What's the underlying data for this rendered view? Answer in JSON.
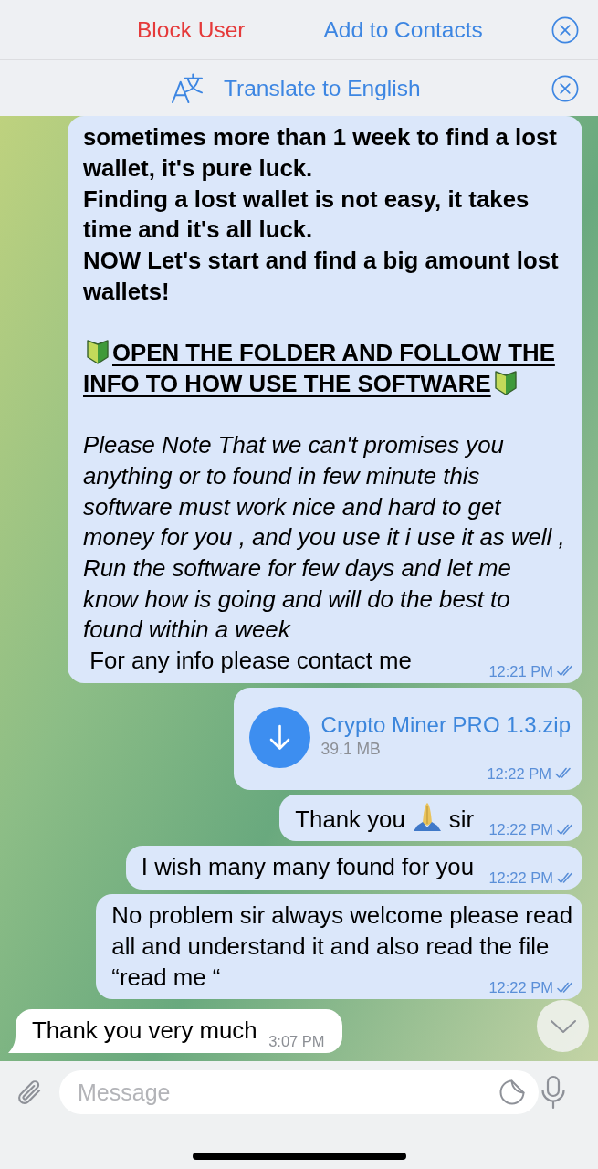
{
  "contact_bar": {
    "block_label": "Block User",
    "add_label": "Add to Contacts"
  },
  "translate_bar": {
    "label": "Translate to English"
  },
  "messages": [
    {
      "kind": "text",
      "outgoing": true,
      "read": true,
      "time": "12:21 PM",
      "blocks": [
        {
          "paragraphs": [
            {
              "kind": "bold",
              "text": "sometimes more than 1 week to find a lost wallet, it's pure luck."
            },
            {
              "kind": "bold",
              "text": "Finding a lost wallet is not easy, it takes time and it's all luck."
            },
            {
              "kind": "bold",
              "text": "NOW Let's start and find a big amount lost wallets!"
            }
          ]
        },
        {
          "paragraphs": [
            {
              "kind": "underline",
              "parts": [
                {
                  "kind": "shield"
                },
                {
                  "kind": "text",
                  "text": "OPEN THE FOLDER AND FOLLOW THE"
                }
              ]
            },
            {
              "kind": "underline",
              "parts": [
                {
                  "kind": "text",
                  "text": "INFO TO HOW USE THE SOFTWARE"
                },
                {
                  "kind": "shield"
                }
              ]
            }
          ]
        },
        {
          "paragraphs": [
            {
              "kind": "italic",
              "text": "Please Note That we can't promises you anything or to found in few minute this software must work nice and hard to get money for you , and you use it i use it as well , Run the software for few days and let me know how is going and will do the best to found within a week"
            },
            {
              "kind": "regular",
              "text": " For any info please contact me"
            }
          ]
        }
      ]
    },
    {
      "kind": "file",
      "outgoing": true,
      "read": true,
      "file_name": "Crypto Miner PRO 1.3.zip",
      "file_size": "39.1 MB",
      "time": "12:22 PM"
    },
    {
      "kind": "text",
      "outgoing": true,
      "read": true,
      "time": "12:22 PM",
      "blocks": [
        {
          "paragraphs": [
            {
              "kind": "regular",
              "parts": [
                {
                  "kind": "text",
                  "text": "Thank you"
                },
                {
                  "kind": "hands"
                },
                {
                  "kind": "text",
                  "text": "sir"
                }
              ]
            }
          ]
        }
      ]
    },
    {
      "kind": "text",
      "outgoing": true,
      "read": true,
      "time": "12:22 PM",
      "blocks": [
        {
          "paragraphs": [
            {
              "kind": "regular",
              "text": "I wish many many found for you"
            }
          ]
        }
      ]
    },
    {
      "kind": "text",
      "outgoing": true,
      "read": true,
      "time": "12:22 PM",
      "blocks": [
        {
          "paragraphs": [
            {
              "kind": "regular",
              "text": "No problem sir always welcome please read"
            },
            {
              "kind": "regular",
              "text": "all and understand it and also read the file"
            },
            {
              "kind": "regular",
              "text": "“read me “"
            }
          ]
        }
      ]
    },
    {
      "kind": "text",
      "outgoing": false,
      "time": "3:07 PM",
      "blocks": [
        {
          "paragraphs": [
            {
              "kind": "regular",
              "text": "Thank you very much"
            }
          ]
        }
      ]
    }
  ],
  "composer": {
    "placeholder": "Message"
  }
}
